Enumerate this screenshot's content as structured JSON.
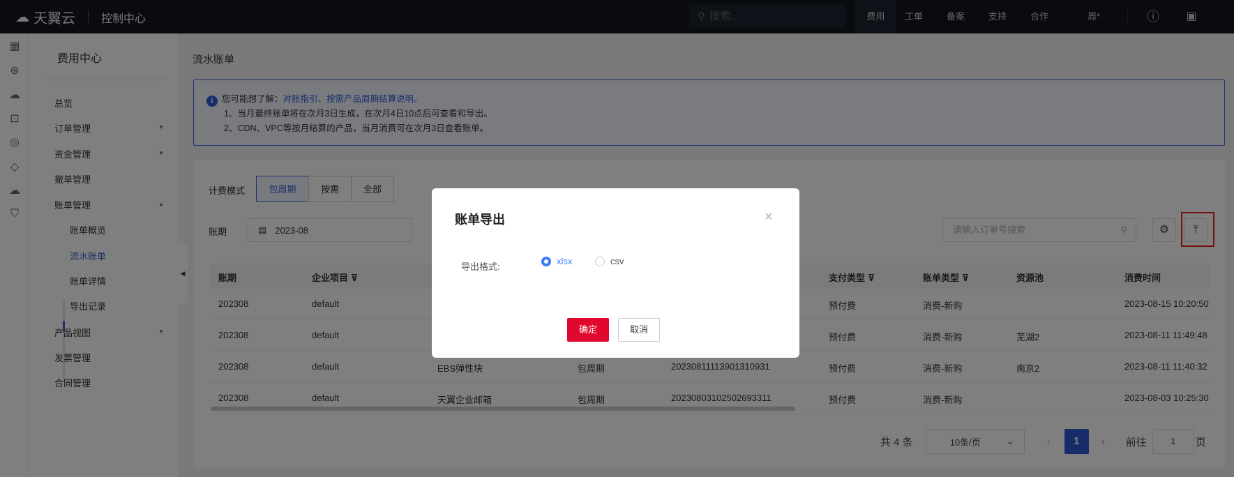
{
  "topbar": {
    "brand": "天翼云",
    "console": "控制中心",
    "search_placeholder": "搜索...",
    "nav": [
      "费用",
      "工单",
      "备案",
      "支持",
      "合作",
      "周*"
    ]
  },
  "sidebar": {
    "title": "费用中心",
    "items": [
      {
        "label": "总览"
      },
      {
        "label": "订单管理"
      },
      {
        "label": "资金管理"
      },
      {
        "label": "撤单管理"
      },
      {
        "label": "账单管理"
      },
      {
        "label": "产品视图"
      },
      {
        "label": "发票管理"
      },
      {
        "label": "合同管理"
      }
    ],
    "sub": [
      "账单概览",
      "流水账单",
      "账单详情",
      "导出记录"
    ]
  },
  "page": {
    "title": "流水账单"
  },
  "info": {
    "prefix": "您可能想了解：",
    "links": "对账指引、按需产品周期结算说明。",
    "line1": "1、当月最终账单将在次月3日生成，在次月4日10点后可查看和导出。",
    "line2": "2、CDN、VPC等按月结算的产品，当月消费可在次月3日查看账单。"
  },
  "filters": {
    "mode_label": "计费模式",
    "modes": [
      "包周期",
      "按需",
      "全部"
    ],
    "period_label": "账期",
    "period_value": "2023-08",
    "search_placeholder": "请输入订单号搜索"
  },
  "table": {
    "headers": [
      "账期",
      "企业项目",
      "支付类型",
      "账单类型",
      "资源池",
      "消费时间"
    ],
    "rows": [
      [
        "202308",
        "default",
        "",
        "",
        "",
        "预付费",
        "消费-新购",
        "",
        "2023-08-15 10:20:50"
      ],
      [
        "202308",
        "default",
        "",
        "",
        "",
        "预付费",
        "消费-新购",
        "芜湖2",
        "2023-08-11 11:49:48"
      ],
      [
        "202308",
        "default",
        "EBS弹性块",
        "包周期",
        "20230811113901310931",
        "预付费",
        "消费-新购",
        "南京2",
        "2023-08-11 11:40:32"
      ],
      [
        "202308",
        "default",
        "天翼企业邮箱",
        "包周期",
        "20230803102502693311",
        "预付费",
        "消费-新购",
        "",
        "2023-08-03 10:25:30"
      ]
    ]
  },
  "pager": {
    "total": "共 4 条",
    "page_size": "10条/页",
    "current": "1",
    "goto_label": "前往",
    "goto_value": "1",
    "page_suffix": "页"
  },
  "modal": {
    "title": "账单导出",
    "format_label": "导出格式:",
    "options": [
      "xlsx",
      "csv"
    ],
    "selected": "xlsx",
    "ok": "确定",
    "cancel": "取消"
  },
  "colors": {
    "accent": "#3a64d8",
    "primary_button": "#e1062c",
    "highlight": "#e8251b"
  }
}
